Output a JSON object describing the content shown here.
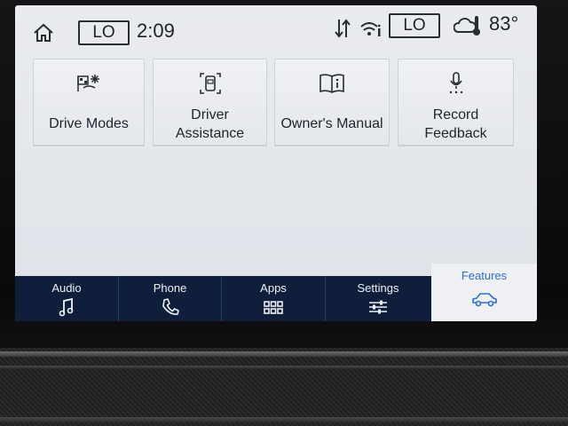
{
  "status_bar": {
    "climate_left": "LO",
    "time": "2:09",
    "climate_right": "LO",
    "temperature": "83°"
  },
  "tiles": [
    {
      "label": "Drive Modes",
      "icon": "drive-modes-icon"
    },
    {
      "label_line1": "Driver",
      "label_line2": "Assistance",
      "icon": "driver-assistance-icon"
    },
    {
      "label": "Owner's Manual",
      "icon": "owners-manual-icon"
    },
    {
      "label_line1": "Record",
      "label_line2": "Feedback",
      "icon": "microphone-icon"
    }
  ],
  "nav": [
    {
      "label": "Audio",
      "icon": "music-note-icon"
    },
    {
      "label": "Phone",
      "icon": "phone-icon"
    },
    {
      "label": "Apps",
      "icon": "apps-grid-icon"
    },
    {
      "label": "Settings",
      "icon": "sliders-icon"
    },
    {
      "label": "Features",
      "icon": "car-icon",
      "active": true
    }
  ],
  "colors": {
    "nav_background": "#0f1e3a",
    "active_accent": "#2f6fd0",
    "screen_background": "#e6e9ee"
  }
}
